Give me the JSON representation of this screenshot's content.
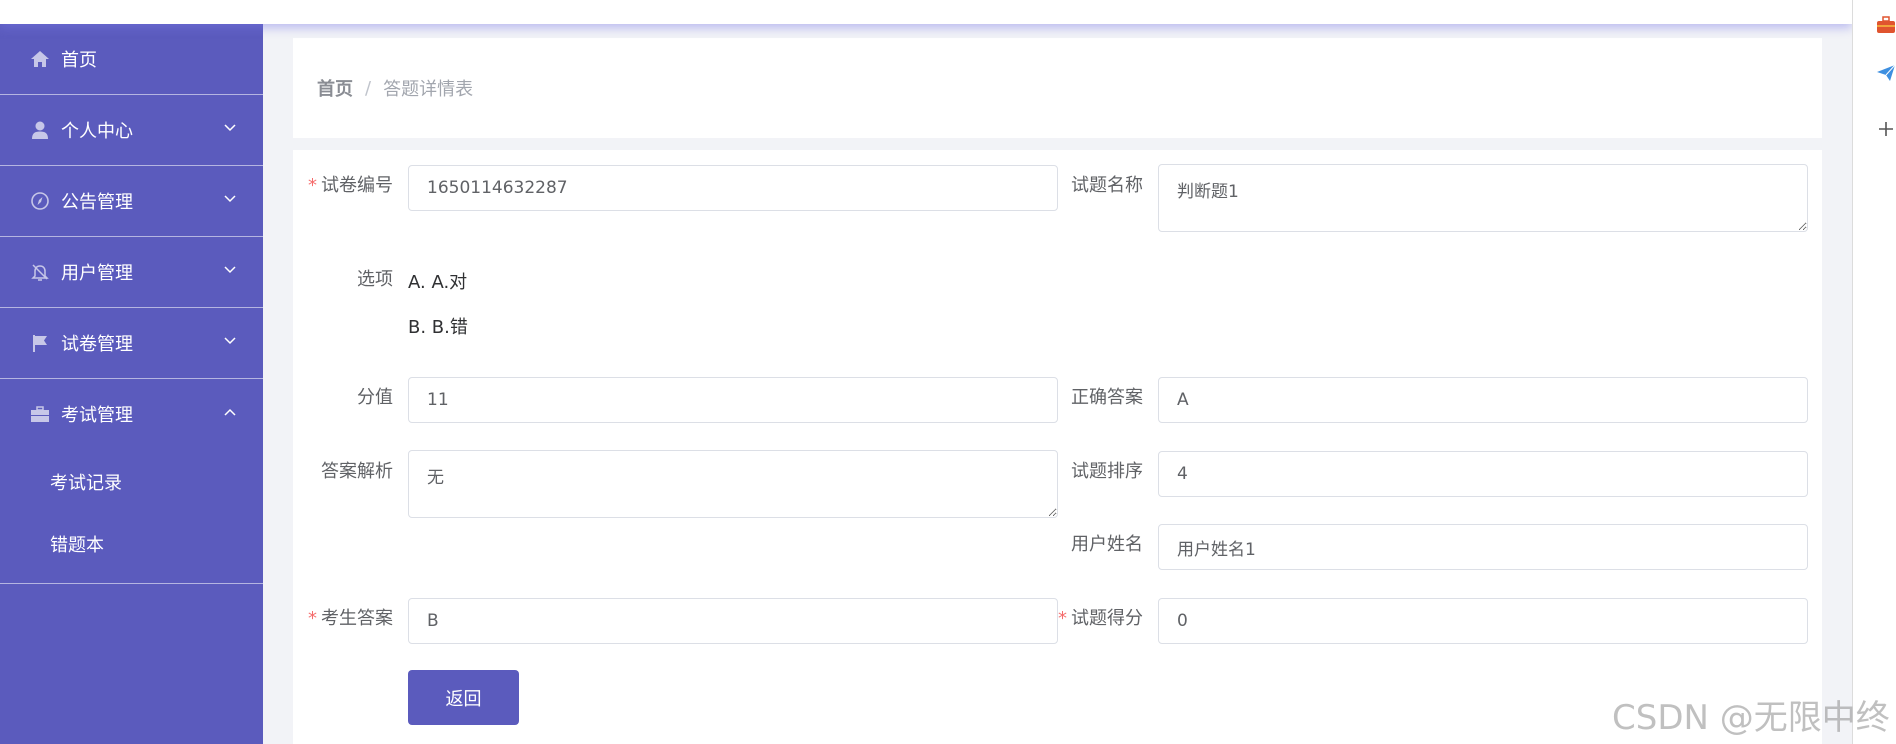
{
  "sidebar": {
    "items": [
      {
        "label": "首页",
        "icon": "home-icon"
      },
      {
        "label": "个人中心",
        "icon": "user-icon"
      },
      {
        "label": "公告管理",
        "icon": "compass-icon"
      },
      {
        "label": "用户管理",
        "icon": "bell-off-icon"
      },
      {
        "label": "试卷管理",
        "icon": "flag-icon"
      },
      {
        "label": "考试管理",
        "icon": "briefcase-icon"
      }
    ],
    "subitems": [
      "考试记录",
      "错题本"
    ]
  },
  "breadcrumb": {
    "home": "首页",
    "separator": "/",
    "current": "答题详情表"
  },
  "form": {
    "paper_no": {
      "label": "试卷编号",
      "value": "1650114632287"
    },
    "question_name": {
      "label": "试题名称",
      "value": "判断题1"
    },
    "options": {
      "label": "选项",
      "items": [
        "A. A.对",
        "B. B.错"
      ]
    },
    "score": {
      "label": "分值",
      "value": "11"
    },
    "correct_answer": {
      "label": "正确答案",
      "value": "A"
    },
    "analysis": {
      "label": "答案解析",
      "value": "无"
    },
    "order": {
      "label": "试题排序",
      "value": "4"
    },
    "user_name": {
      "label": "用户姓名",
      "value": "用户姓名1"
    },
    "student_answer": {
      "label": "考生答案",
      "value": "B"
    },
    "question_score": {
      "label": "试题得分",
      "value": "0"
    },
    "back_label": "返回"
  },
  "watermark": "CSDN @无限中终",
  "colors": {
    "sidebar": "#5b5bbd",
    "accent": "#5b5bbd",
    "required": "#f56c6c"
  }
}
